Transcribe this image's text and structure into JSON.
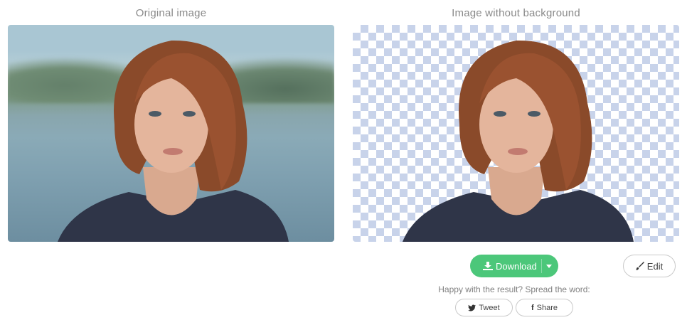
{
  "panels": {
    "original_title": "Original image",
    "result_title": "Image without background"
  },
  "actions": {
    "download_label": "Download",
    "edit_label": "Edit",
    "share_prompt": "Happy with the result? Spread the word:",
    "tweet_label": "Tweet",
    "share_label": "Share"
  },
  "colors": {
    "download_green": "#4cc77a",
    "checker_blue": "#c8d3ea"
  },
  "icons": {
    "download": "download-icon",
    "dropdown": "caret-down-icon",
    "edit": "brush-icon",
    "tweet": "twitter-icon",
    "share": "facebook-icon"
  }
}
